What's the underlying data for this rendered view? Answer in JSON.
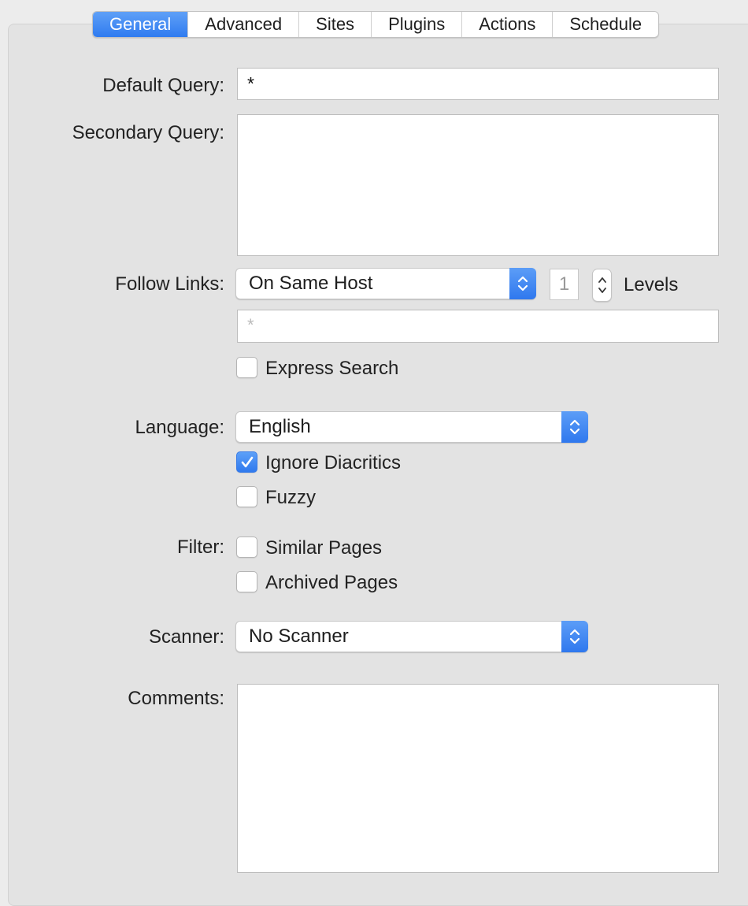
{
  "tabs": [
    {
      "label": "General",
      "active": true
    },
    {
      "label": "Advanced",
      "active": false
    },
    {
      "label": "Sites",
      "active": false
    },
    {
      "label": "Plugins",
      "active": false
    },
    {
      "label": "Actions",
      "active": false
    },
    {
      "label": "Schedule",
      "active": false
    }
  ],
  "labels": {
    "default_query": "Default Query:",
    "secondary_query": "Secondary Query:",
    "follow_links": "Follow Links:",
    "language": "Language:",
    "filter": "Filter:",
    "scanner": "Scanner:",
    "comments": "Comments:"
  },
  "default_query": {
    "value": "*"
  },
  "secondary_query": {
    "value": ""
  },
  "follow_links": {
    "selected": "On Same Host",
    "levels_value": "1",
    "levels_label": "Levels",
    "pattern_placeholder": "*"
  },
  "express_search": {
    "label": "Express Search",
    "checked": false
  },
  "language": {
    "selected": "English"
  },
  "ignore_diacritics": {
    "label": "Ignore Diacritics",
    "checked": true
  },
  "fuzzy": {
    "label": "Fuzzy",
    "checked": false
  },
  "similar_pages": {
    "label": "Similar Pages",
    "checked": false
  },
  "archived_pages": {
    "label": "Archived Pages",
    "checked": false
  },
  "scanner": {
    "selected": "No Scanner"
  },
  "comments": {
    "value": ""
  },
  "colors": {
    "accent": "#2f7bf0",
    "panel": "#e3e3e3"
  }
}
